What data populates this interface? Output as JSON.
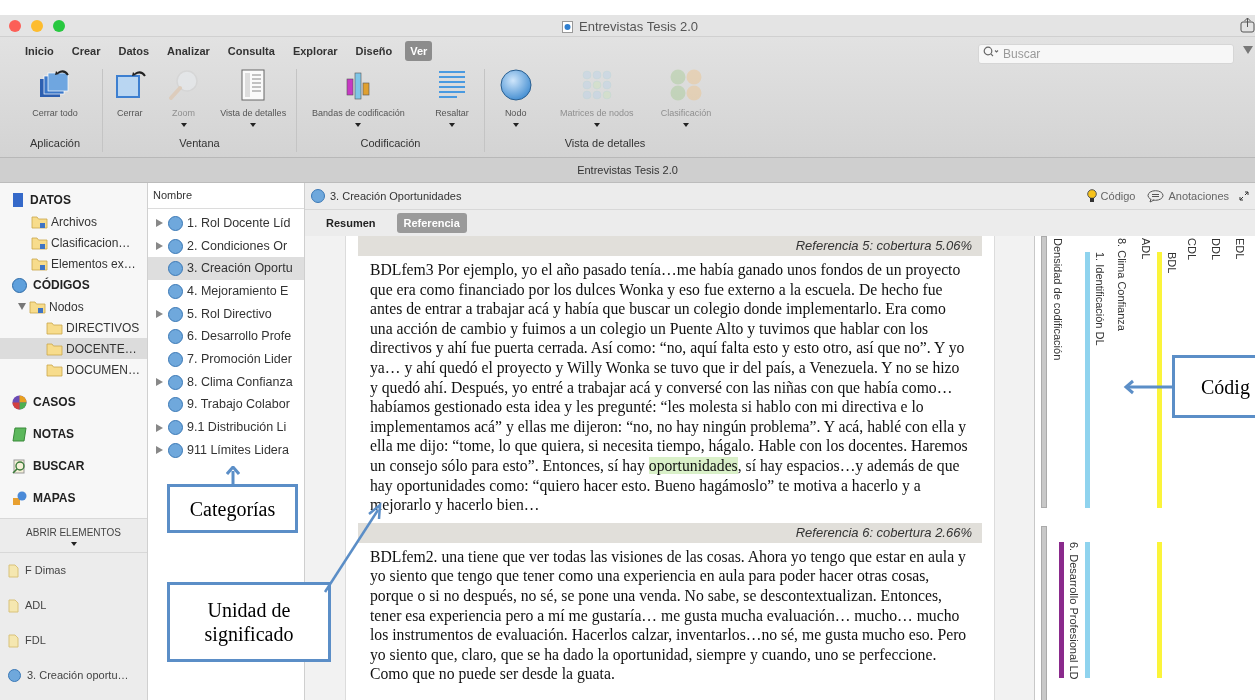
{
  "window": {
    "title": "Entrevistas Tesis 2.0"
  },
  "ribbon": {
    "tabs": [
      {
        "label": "Inicio",
        "selected": false
      },
      {
        "label": "Crear",
        "selected": false
      },
      {
        "label": "Datos",
        "selected": false
      },
      {
        "label": "Analizar",
        "selected": false
      },
      {
        "label": "Consulta",
        "selected": false
      },
      {
        "label": "Explorar",
        "selected": false
      },
      {
        "label": "Diseño",
        "selected": false
      },
      {
        "label": "Ver",
        "selected": true
      }
    ],
    "search": {
      "placeholder": "Buscar"
    },
    "groups": [
      {
        "label": "Aplicación",
        "buttons": [
          {
            "label": "Cerrar todo",
            "disabled": false,
            "dropdown": false
          }
        ]
      },
      {
        "label": "Ventana",
        "buttons": [
          {
            "label": "Cerrar",
            "disabled": false,
            "dropdown": false
          },
          {
            "label": "Zoom",
            "disabled": true,
            "dropdown": true
          },
          {
            "label": "Vista de detalles",
            "disabled": false,
            "dropdown": true
          }
        ]
      },
      {
        "label": "Codificación",
        "buttons": [
          {
            "label": "Bandas de codificación",
            "disabled": false,
            "dropdown": true
          },
          {
            "label": "Resaltar",
            "disabled": false,
            "dropdown": true
          }
        ]
      },
      {
        "label": "Vista de detalles",
        "buttons": [
          {
            "label": "Nodo",
            "disabled": false,
            "dropdown": true
          },
          {
            "label": "Matrices de nodos",
            "disabled": true,
            "dropdown": true
          },
          {
            "label": "Clasificación",
            "disabled": true,
            "dropdown": true
          }
        ]
      }
    ]
  },
  "project_bar": {
    "title": "Entrevistas Tesis 2.0"
  },
  "navigator": {
    "sections": [
      {
        "label": "DATOS",
        "children": [
          {
            "label": "Archivos",
            "selected": false
          },
          {
            "label": "Clasificacion…",
            "selected": false
          },
          {
            "label": "Elementos ex…",
            "selected": false
          }
        ]
      },
      {
        "label": "CÓDIGOS",
        "children": [
          {
            "label": "Nodos",
            "selected": false,
            "expanded": true,
            "children": [
              {
                "label": "DIRECTIVOS",
                "selected": false
              },
              {
                "label": "DOCENTE…",
                "selected": true
              },
              {
                "label": "DOCUMEN…",
                "selected": false
              }
            ]
          }
        ]
      },
      {
        "label": "CASOS"
      },
      {
        "label": "NOTAS"
      },
      {
        "label": "BUSCAR"
      },
      {
        "label": "MAPAS"
      }
    ],
    "open_items_header": "ABRIR ELEMENTOS",
    "open_items": [
      {
        "label": "F Dimas",
        "kind": "document"
      },
      {
        "label": "ADL",
        "kind": "document"
      },
      {
        "label": "FDL",
        "kind": "document"
      },
      {
        "label": "3. Creación oportu…",
        "kind": "node"
      }
    ]
  },
  "node_list": {
    "column": "Nombre",
    "rows": [
      {
        "label": "1. Rol Docente Líd",
        "expandable": true,
        "selected": false
      },
      {
        "label": "2. Condiciones Or",
        "expandable": true,
        "selected": false
      },
      {
        "label": "3. Creación Oportu",
        "expandable": false,
        "selected": true
      },
      {
        "label": "4. Mejoramiento E",
        "expandable": false,
        "selected": false
      },
      {
        "label": "5. Rol Directivo",
        "expandable": true,
        "selected": false
      },
      {
        "label": "6. Desarrollo Profe",
        "expandable": false,
        "selected": false
      },
      {
        "label": "7. Promoción Lider",
        "expandable": false,
        "selected": false
      },
      {
        "label": "8. Clima Confianza",
        "expandable": true,
        "selected": false
      },
      {
        "label": "9. Trabajo Colabor",
        "expandable": false,
        "selected": false
      },
      {
        "label": "9.1 Distribución Li",
        "expandable": true,
        "selected": false
      },
      {
        "label": "911 Límites Lidera",
        "expandable": true,
        "selected": false
      }
    ]
  },
  "detail": {
    "title": "3. Creación Oportunidades",
    "actions": [
      "Código",
      "Anotaciones"
    ],
    "tabs": [
      {
        "label": "Resumen",
        "selected": false
      },
      {
        "label": "Referencia",
        "selected": true
      }
    ],
    "references": [
      {
        "header": "Referencia 5: cobertura 5.06%",
        "segments": [
          {
            "text": "BDLfem3 Por ejemplo, yo el año pasado tenía…me había ganado unos fondos de un proyecto que era como financiado por los dulces Wonka y eso fue externo a la escuela. De hecho fue antes de entrar a trabajar acá y había que buscar un colegio donde implementarlo. Era como una acción de cambio y fuimos a un colegio un Puente Alto y tuvimos que hablar con los directivos y ahí fue puerta cerrada. Así como: “no, aquí falta esto y esto otro, así que no”. Y yo ya… y ahí quedó el proyecto y Willy Wonka se tuvo que ir del país, a Venezuela. Y no se hizo y quedó ahí. Después, yo entré a trabajar acá y conversé con las niñas con que había como… habíamos gestionado esta idea y les pregunté: “les molesta si hablo con mi directiva e lo implementamos acá” y ellas me dijeron: “no, no hay ningún problema”. Y acá,  hablé con ella y ella me dijo: “tome, lo que quiera, si necesita tiempo, hágalo. Hable con los docentes. Haremos un consejo sólo para esto”. Entonces, sí hay ",
            "highlighted": false
          },
          {
            "text": "oportunidades",
            "highlighted": true
          },
          {
            "text": ", sí hay espacios…y además de que hay oportunidades como: “quiero hacer esto. Bueno hagámoslo” te motiva a hacerlo y a mejorarlo y hacerlo bien…",
            "highlighted": false
          }
        ]
      },
      {
        "header": "Referencia 6: cobertura 2.66%",
        "segments": [
          {
            "text": "BDLfem2. una tiene que ver todas las visiones de las cosas. Ahora yo tengo que estar en aula y yo siento que tengo que tener como una experiencia en aula para poder hacer otras cosas, porque o si no después, no sé, se pone una venda. No sabe, se descontextualizan. Entonces, tener esa experiencia pero a mí me gustaría… me gusta mucha evaluación… mucho… mucho los instrumentos de evaluación. Hacerlos calzar, inventarlos…no sé, me gusta mucho eso. Pero yo siento que, claro, que se ha dado la oportunidad, siempre y cuando, uno se perfeccione. Como que no puede ser desde la guata.",
            "highlighted": false
          }
        ]
      }
    ],
    "coding_stripes": [
      {
        "kind": "density",
        "label": "Densidad de codificación"
      },
      {
        "kind": "stripe",
        "label": "6. Desarrollo Profesional LD",
        "color": "#8a2a8c",
        "coded": [
          false,
          true
        ]
      },
      {
        "kind": "stripe",
        "label": "1. Identificación DL",
        "color": "#8fd3ee",
        "coded": [
          true,
          true
        ]
      },
      {
        "kind": "label",
        "label": "8. Clima Confianza"
      },
      {
        "kind": "label",
        "label": "ADL"
      },
      {
        "kind": "stripe",
        "label": "BDL",
        "color": "#fbf43a",
        "coded": [
          true,
          true
        ]
      },
      {
        "kind": "label",
        "label": "CDL"
      },
      {
        "kind": "label",
        "label": "DDL"
      },
      {
        "kind": "label",
        "label": "EDL"
      }
    ]
  },
  "annotations": [
    {
      "text": "Categorías"
    },
    {
      "text": "Unidad de significado"
    },
    {
      "text": "Códig"
    }
  ]
}
